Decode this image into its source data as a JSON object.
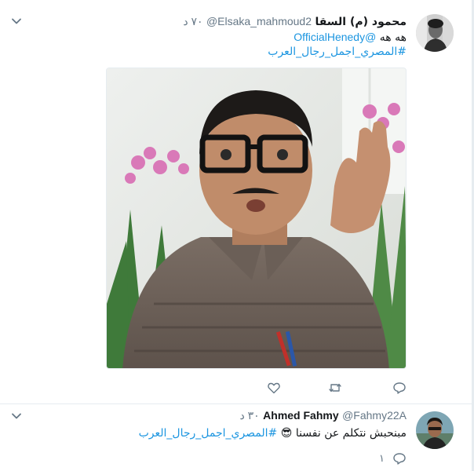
{
  "tweets": [
    {
      "display_name": "محمود (م) السقا",
      "screen_name": "@Elsaka_mahmoud2",
      "time": "٧٠ د",
      "text_line1": "هه هه",
      "mention": "@OfficialHenedy",
      "hashtag": "#المصري_اجمل_رجال_العرب",
      "avatar_icon": "user-avatar-photo",
      "media_icon": "attached-photo"
    },
    {
      "display_name": "Ahmed Fahmy",
      "screen_name": "@Fahmy22A",
      "time": "٣٠ د",
      "text": "مبنحبش نتكلم عن نفسنا",
      "emoji": "😎",
      "hashtag": "#المصري_اجمل_رجال_العرب",
      "reply_count": "١"
    }
  ],
  "colors": {
    "link": "#1b95e0",
    "secondary_text": "#657786",
    "border": "#e6ecf0"
  }
}
